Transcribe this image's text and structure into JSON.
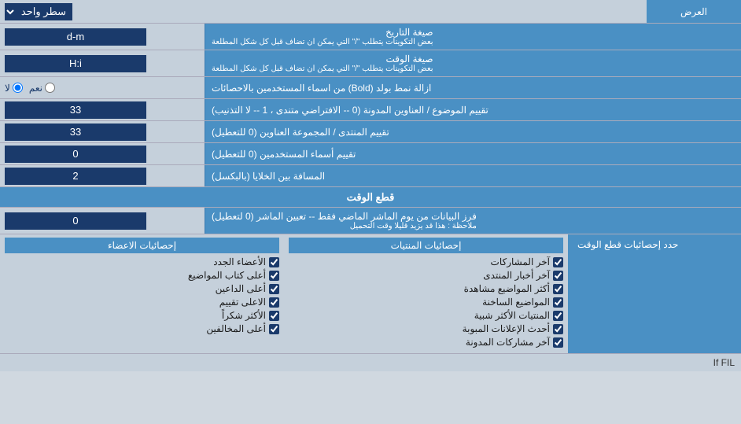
{
  "header": {
    "title": "العرض",
    "mode_label": "سطر واحد"
  },
  "rows": [
    {
      "id": "date_format",
      "label": "صيغة التاريخ",
      "sublabel": "بعض التكوينات يتطلب \"/\" التي يمكن ان تضاف قبل كل شكل المطلعة",
      "value": "d-m",
      "type": "input"
    },
    {
      "id": "time_format",
      "label": "صيغة الوقت",
      "sublabel": "بعض التكوينات يتطلب \"/\" التي يمكن ان تضاف قبل كل شكل المطلعة",
      "value": "H:i",
      "type": "input"
    },
    {
      "id": "bold_remove",
      "label": "ازالة نمط بولد (Bold) من اسماء المستخدمين بالاحصائات",
      "value_yes": "نعم",
      "value_no": "لا",
      "selected": "no",
      "type": "radio"
    },
    {
      "id": "topics_sort",
      "label": "تقييم الموضوع / العناوين المدونة (0 -- الافتراضي متندى ، 1 -- لا التذنيب)",
      "value": "33",
      "type": "input"
    },
    {
      "id": "forum_sort",
      "label": "تقييم المنتدى / المجموعة العناوين (0 للتعطيل)",
      "value": "33",
      "type": "input"
    },
    {
      "id": "users_sort",
      "label": "تقييم أسماء المستخدمين (0 للتعطيل)",
      "value": "0",
      "type": "input"
    },
    {
      "id": "cell_spacing",
      "label": "المسافة بين الخلايا (بالبكسل)",
      "value": "2",
      "type": "input"
    }
  ],
  "cutoff_section": {
    "title": "قطع الوقت",
    "row": {
      "label": "فرز البيانات من يوم الماشر الماضي فقط -- تعيين الماشر (0 لتعطيل)",
      "note": "ملاحظة : هذا قد يزيد قليلا وقت التحميل",
      "value": "0"
    },
    "limit_label": "حدد إحصائيات قطع الوقت"
  },
  "stats": {
    "post_stats_header": "إحصائيات المنتيات",
    "member_stats_header": "إحصائيات الاعضاء",
    "post_items": [
      {
        "label": "آخر المشاركات",
        "checked": true
      },
      {
        "label": "آخر أخبار المنتدى",
        "checked": true
      },
      {
        "label": "أكثر المواضيع مشاهدة",
        "checked": true
      },
      {
        "label": "المواضيع الساخنة",
        "checked": true
      },
      {
        "label": "المنتيات الأكثر شبية",
        "checked": true
      },
      {
        "label": "أحدث الإعلانات المبوبة",
        "checked": true
      },
      {
        "label": "آخر مشاركات المدونة",
        "checked": true
      }
    ],
    "member_items": [
      {
        "label": "الأعضاء الجدد",
        "checked": true
      },
      {
        "label": "أعلى كتاب المواضيع",
        "checked": true
      },
      {
        "label": "أعلى الداعين",
        "checked": true
      },
      {
        "label": "الاعلى تقييم",
        "checked": true
      },
      {
        "label": "الأكثر شكراً",
        "checked": true
      },
      {
        "label": "أعلى المخالفين",
        "checked": true
      }
    ]
  },
  "bottom_note": "If FIL"
}
